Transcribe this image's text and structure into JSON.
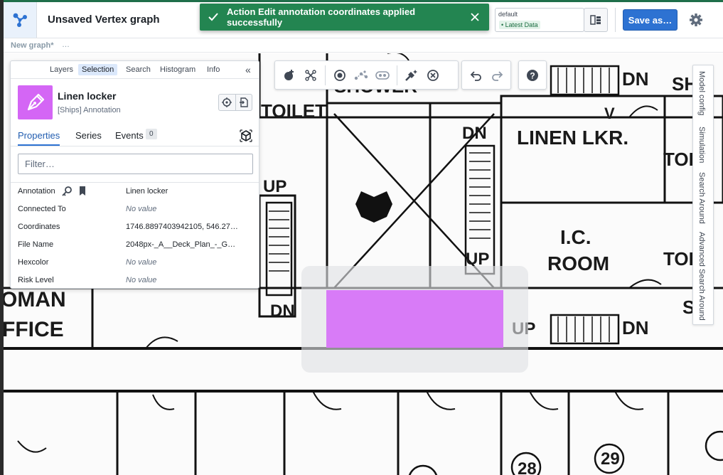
{
  "header": {
    "title": "Unsaved Vertex graph",
    "branch": {
      "name": "default",
      "badge": "• Latest Data"
    },
    "save_label": "Save as…"
  },
  "toast": {
    "message": "Action Edit annotation coordinates applied successfully"
  },
  "breadcrumb": {
    "graph_name": "New graph*",
    "ellipsis": "…"
  },
  "panel": {
    "tabs": [
      "Layers",
      "Selection",
      "Search",
      "Histogram",
      "Info"
    ],
    "active_tab": "Selection",
    "object": {
      "title": "Linen locker",
      "subtitle": "[Ships] Annotation",
      "icon_color": "#D466F5"
    },
    "subtabs": {
      "properties": "Properties",
      "series": "Series",
      "events": "Events",
      "events_count": "0"
    },
    "filter_placeholder": "Filter…",
    "properties": [
      {
        "key": "Annotation",
        "value": "Linen locker",
        "empty": false
      },
      {
        "key": "Connected To",
        "value": "No value",
        "empty": true
      },
      {
        "key": "Coordinates",
        "value": "1746.8897403942105, 546.27…",
        "empty": false
      },
      {
        "key": "File Name",
        "value": "2048px-_A__Deck_Plan_-_G…",
        "empty": false
      },
      {
        "key": "Hexcolor",
        "value": "No value",
        "empty": true
      },
      {
        "key": "Risk Level",
        "value": "No value",
        "empty": true
      }
    ]
  },
  "right_tabs": [
    "Model config",
    "Simulation",
    "Search Around",
    "Advanced Search Around"
  ],
  "floorplan_labels": {
    "shower": "SHOWER",
    "toilet": "TOILET",
    "linen": "LINEN LKR.",
    "dn": "DN",
    "up": "UP",
    "ic": "I.C.",
    "room": "ROOM",
    "toi": "TOI",
    "sh": "SH",
    "woman": "OMAN",
    "office": "FFICE",
    "v": "V",
    "n28": "28",
    "n29": "29"
  },
  "colors": {
    "accent": "#2D72D2",
    "toast": "#238551",
    "annotation": "#D87BF7"
  }
}
